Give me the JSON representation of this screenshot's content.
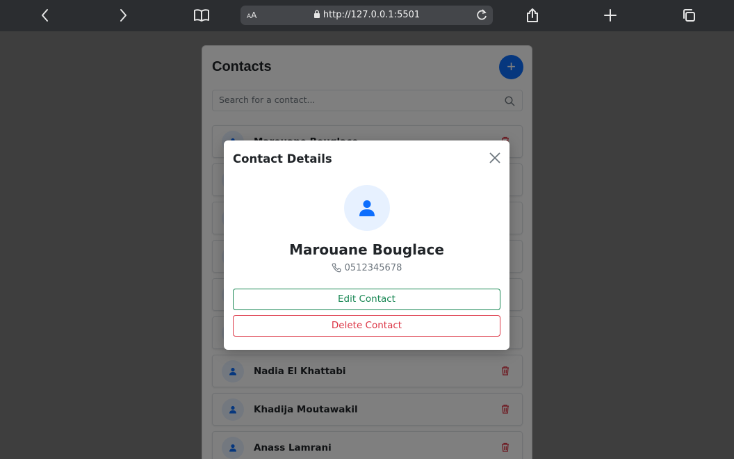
{
  "browser": {
    "reader_label_small": "A",
    "reader_label_large": "A",
    "url": "http://127.0.0.1:5501"
  },
  "app": {
    "title": "Contacts",
    "add_label": "+",
    "search_placeholder": "Search for a contact...",
    "accent_color": "#0d6efd",
    "contacts": [
      {
        "name": "Marouane Bouglace"
      },
      {
        "name": ""
      },
      {
        "name": ""
      },
      {
        "name": ""
      },
      {
        "name": ""
      },
      {
        "name": ""
      },
      {
        "name": "Nadia El Khattabi"
      },
      {
        "name": "Khadija Moutawakil"
      },
      {
        "name": "Anass Lamrani"
      }
    ]
  },
  "modal": {
    "title": "Contact Details",
    "name": "Marouane Bouglace",
    "phone": "0512345678",
    "edit_label": "Edit Contact",
    "delete_label": "Delete Contact",
    "edit_color": "#198754",
    "delete_color": "#dc3545"
  }
}
